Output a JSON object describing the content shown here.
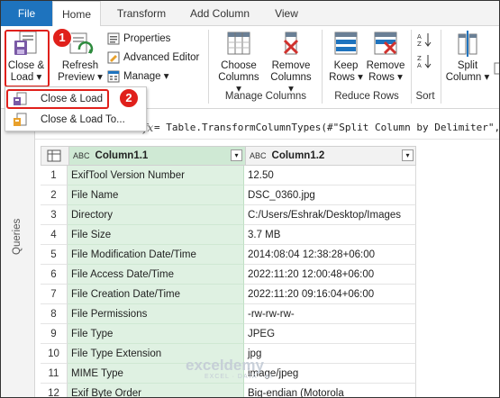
{
  "tabs": [
    "File",
    "Home",
    "Transform",
    "Add Column",
    "View"
  ],
  "ribbon": {
    "close_load": {
      "line1": "Close &",
      "line2": "Load ▾"
    },
    "refresh_preview": {
      "line1": "Refresh",
      "line2": "Preview ▾"
    },
    "properties": "Properties",
    "advanced_editor": "Advanced Editor",
    "manage": "Manage ▾",
    "choose_columns": {
      "line1": "Choose",
      "line2": "Columns ▾"
    },
    "remove_columns": {
      "line1": "Remove",
      "line2": "Columns ▾"
    },
    "keep_rows": {
      "line1": "Keep",
      "line2": "Rows ▾"
    },
    "remove_rows": {
      "line1": "Remove",
      "line2": "Rows ▾"
    },
    "split_column": {
      "line1": "Split",
      "line2": "Column ▾"
    },
    "groups": {
      "manage_columns": "Manage Columns",
      "reduce_rows": "Reduce Rows",
      "sort": "Sort"
    }
  },
  "menu": {
    "close_load": "Close & Load",
    "close_load_to": "Close & Load To..."
  },
  "badges": {
    "one": "1",
    "two": "2"
  },
  "queries_label": "Queries",
  "formula": {
    "fx": "fx",
    "text": "= Table.TransformColumnTypes(#\"Split Column by Delimiter\","
  },
  "columns": [
    {
      "type": "ABC",
      "name": "Column1.1"
    },
    {
      "type": "ABC",
      "name": "Column1.2"
    }
  ],
  "rows": [
    {
      "n": "1",
      "a": "ExifTool Version Number",
      "b": "12.50"
    },
    {
      "n": "2",
      "a": "File Name",
      "b": "DSC_0360.jpg"
    },
    {
      "n": "3",
      "a": "Directory",
      "b": "C:/Users/Eshrak/Desktop/Images"
    },
    {
      "n": "4",
      "a": "File Size",
      "b": "3.7 MB"
    },
    {
      "n": "5",
      "a": "File Modification Date/Time",
      "b": "2014:08:04 12:38:28+06:00"
    },
    {
      "n": "6",
      "a": "File Access Date/Time",
      "b": "2022:11:20 12:00:48+06:00"
    },
    {
      "n": "7",
      "a": "File Creation Date/Time",
      "b": "2022:11:20 09:16:04+06:00"
    },
    {
      "n": "8",
      "a": "File Permissions",
      "b": "-rw-rw-rw-"
    },
    {
      "n": "9",
      "a": "File Type",
      "b": "JPEG"
    },
    {
      "n": "10",
      "a": "File Type Extension",
      "b": "jpg"
    },
    {
      "n": "11",
      "a": "MIME Type",
      "b": "image/jpeg"
    },
    {
      "n": "12",
      "a": "Exif Byte Order",
      "b": "Big-endian (Motorola"
    }
  ],
  "watermark": {
    "name": "exceldemy",
    "sub": "EXCEL · DATA · BI"
  },
  "colors": {
    "file_tab": "#1e73be",
    "highlight": "#e0201b",
    "column_fill": "#dff1e2"
  }
}
